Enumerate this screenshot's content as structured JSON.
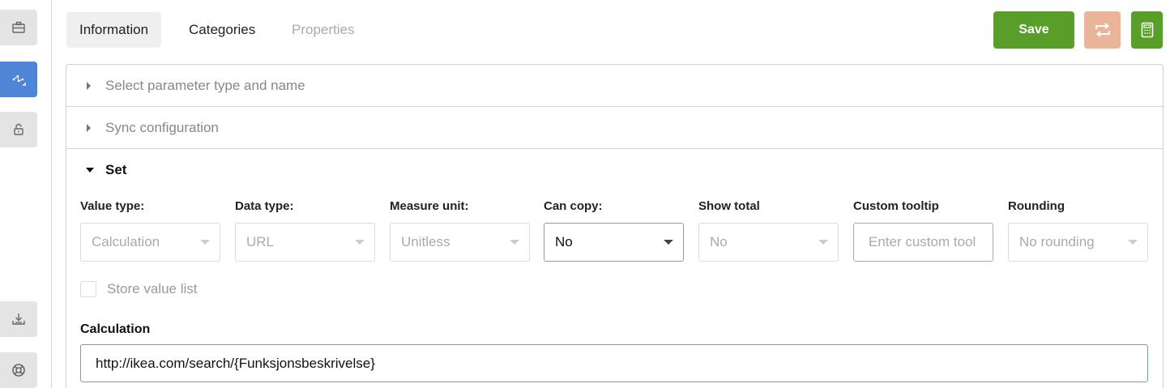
{
  "rail": {
    "items": [
      {
        "icon": "briefcase-icon",
        "active": false
      },
      {
        "icon": "node-graph-icon",
        "active": true
      },
      {
        "icon": "lock-icon",
        "active": false
      },
      {
        "icon": "download-icon",
        "active": false
      },
      {
        "icon": "lifebuoy-icon",
        "active": false
      }
    ]
  },
  "tabs": [
    {
      "label": "Information",
      "state": "selected"
    },
    {
      "label": "Categories",
      "state": "normal"
    },
    {
      "label": "Properties",
      "state": "disabled"
    }
  ],
  "toolbar": {
    "save_label": "Save",
    "swap_icon": "swap-arrows-icon",
    "calc_icon": "calculator-icon"
  },
  "accordion": {
    "section1": "Select parameter type and name",
    "section2": "Sync configuration",
    "section3": "Set"
  },
  "fields": {
    "value_type": {
      "label": "Value type:",
      "value": "Calculation"
    },
    "data_type": {
      "label": "Data type:",
      "value": "URL"
    },
    "measure_unit": {
      "label": "Measure unit:",
      "value": "Unitless"
    },
    "can_copy": {
      "label": "Can copy:",
      "value": "No"
    },
    "show_total": {
      "label": "Show total",
      "value": "No"
    },
    "custom_tooltip": {
      "label": "Custom tooltip",
      "placeholder": "Enter custom tool"
    },
    "rounding": {
      "label": "Rounding",
      "value": "No rounding"
    }
  },
  "store_value_list": {
    "label": "Store value list",
    "checked": false
  },
  "calculation": {
    "label": "Calculation",
    "value": "http://ikea.com/search/{Funksjonsbeskrivelse}"
  },
  "colors": {
    "accent_blue": "#4f84d6",
    "save_green": "#5a9e2a",
    "swap_peach": "#e9b49a"
  }
}
